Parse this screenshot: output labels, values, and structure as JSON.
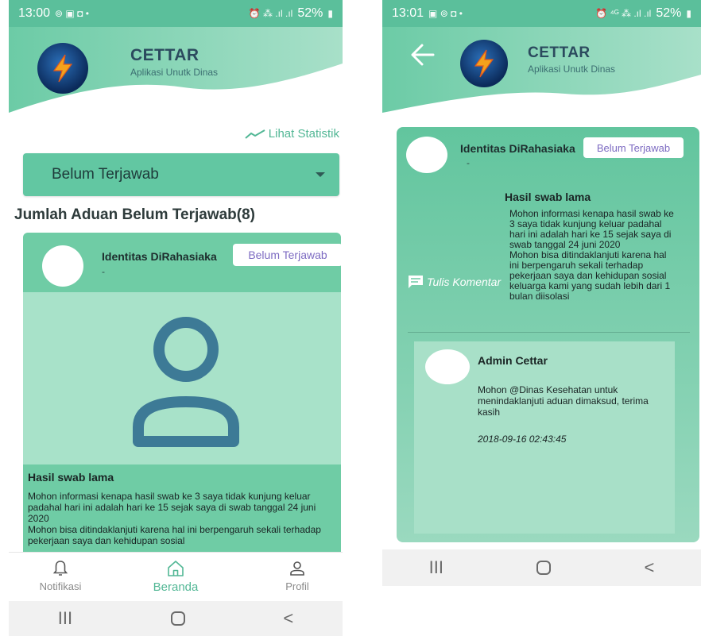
{
  "left": {
    "status": {
      "time": "13:00",
      "icons": "⊚ ▣ ◘ •",
      "right_icons": "⏰ ⁂ .ıl .ıl",
      "battery": "52%"
    },
    "app": {
      "title": "CETTAR",
      "subtitle": "Aplikasi Unutk Dinas"
    },
    "stat_link": "Lihat Statistik",
    "filter": {
      "selected": "Belum Terjawab"
    },
    "count_heading": "Jumlah Aduan Belum Terjawab(8)",
    "card": {
      "name": "Identitas DiRahasiaka",
      "dash": "-",
      "badge": "Belum Terjawab",
      "title": "Hasil swab lama",
      "body": "Mohon informasi kenapa hasil swab ke 3 saya tidak kunjung keluar padahal hari ini adalah hari ke 15 sejak saya di swab tanggal 24 juni 2020\nMohon bisa ditindaklanjuti karena hal ini berpengaruh sekali terhadap pekerjaan saya dan kehidupan sosial"
    },
    "nav": {
      "notif": "Notifikasi",
      "home": "Beranda",
      "profile": "Profil"
    },
    "sysnav": {
      "recent": "III",
      "back": "<"
    }
  },
  "right": {
    "status": {
      "time": "13:01",
      "icons": "▣ ⊚ ◘ •",
      "right_icons": "⏰ ⁴ᴳ ⁂ .ıl .ıl",
      "battery": "52%"
    },
    "app": {
      "title": "CETTAR",
      "subtitle": "Aplikasi Unutk Dinas"
    },
    "card": {
      "name": "Identitas DiRahasiaka",
      "dash": "-",
      "badge": "Belum Terjawab",
      "title": "Hasil swab lama",
      "body": "Mohon informasi kenapa hasil swab ke 3 saya tidak kunjung keluar padahal hari ini adalah hari ke 15 sejak saya di swab tanggal 24 juni 2020\nMohon bisa ditindaklanjuti karena hal ini berpengaruh sekali terhadap pekerjaan saya dan kehidupan sosial keluarga kami yang sudah lebih dari 1 bulan diisolasi",
      "comment_label": "Tulis Komentar"
    },
    "reply": {
      "name": "Admin Cettar",
      "body": "Mohon @Dinas Kesehatan  untuk menindaklanjuti aduan dimaksud, terima kasih",
      "time": "2018-09-16 02:43:45"
    },
    "sysnav": {
      "recent": "III",
      "back": "<"
    }
  },
  "colors": {
    "primary": "#5bbf9b",
    "card": "#6fcca5",
    "badge_text": "#7d6bc2",
    "logo": "#0b2a5a",
    "bolt": "#f3a21c"
  }
}
